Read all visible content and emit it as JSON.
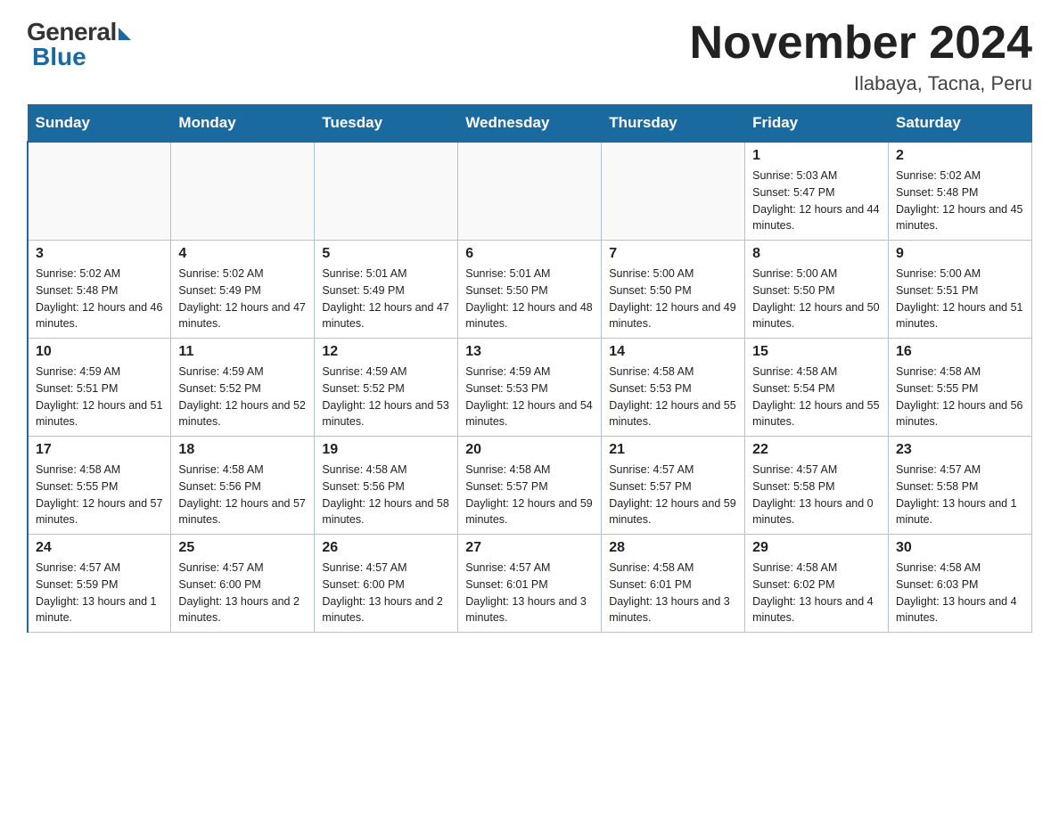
{
  "header": {
    "logo_general": "General",
    "logo_blue": "Blue",
    "title": "November 2024",
    "subtitle": "Ilabaya, Tacna, Peru"
  },
  "days_of_week": [
    "Sunday",
    "Monday",
    "Tuesday",
    "Wednesday",
    "Thursday",
    "Friday",
    "Saturday"
  ],
  "weeks": [
    [
      {
        "day": "",
        "info": ""
      },
      {
        "day": "",
        "info": ""
      },
      {
        "day": "",
        "info": ""
      },
      {
        "day": "",
        "info": ""
      },
      {
        "day": "",
        "info": ""
      },
      {
        "day": "1",
        "info": "Sunrise: 5:03 AM\nSunset: 5:47 PM\nDaylight: 12 hours and 44 minutes."
      },
      {
        "day": "2",
        "info": "Sunrise: 5:02 AM\nSunset: 5:48 PM\nDaylight: 12 hours and 45 minutes."
      }
    ],
    [
      {
        "day": "3",
        "info": "Sunrise: 5:02 AM\nSunset: 5:48 PM\nDaylight: 12 hours and 46 minutes."
      },
      {
        "day": "4",
        "info": "Sunrise: 5:02 AM\nSunset: 5:49 PM\nDaylight: 12 hours and 47 minutes."
      },
      {
        "day": "5",
        "info": "Sunrise: 5:01 AM\nSunset: 5:49 PM\nDaylight: 12 hours and 47 minutes."
      },
      {
        "day": "6",
        "info": "Sunrise: 5:01 AM\nSunset: 5:50 PM\nDaylight: 12 hours and 48 minutes."
      },
      {
        "day": "7",
        "info": "Sunrise: 5:00 AM\nSunset: 5:50 PM\nDaylight: 12 hours and 49 minutes."
      },
      {
        "day": "8",
        "info": "Sunrise: 5:00 AM\nSunset: 5:50 PM\nDaylight: 12 hours and 50 minutes."
      },
      {
        "day": "9",
        "info": "Sunrise: 5:00 AM\nSunset: 5:51 PM\nDaylight: 12 hours and 51 minutes."
      }
    ],
    [
      {
        "day": "10",
        "info": "Sunrise: 4:59 AM\nSunset: 5:51 PM\nDaylight: 12 hours and 51 minutes."
      },
      {
        "day": "11",
        "info": "Sunrise: 4:59 AM\nSunset: 5:52 PM\nDaylight: 12 hours and 52 minutes."
      },
      {
        "day": "12",
        "info": "Sunrise: 4:59 AM\nSunset: 5:52 PM\nDaylight: 12 hours and 53 minutes."
      },
      {
        "day": "13",
        "info": "Sunrise: 4:59 AM\nSunset: 5:53 PM\nDaylight: 12 hours and 54 minutes."
      },
      {
        "day": "14",
        "info": "Sunrise: 4:58 AM\nSunset: 5:53 PM\nDaylight: 12 hours and 55 minutes."
      },
      {
        "day": "15",
        "info": "Sunrise: 4:58 AM\nSunset: 5:54 PM\nDaylight: 12 hours and 55 minutes."
      },
      {
        "day": "16",
        "info": "Sunrise: 4:58 AM\nSunset: 5:55 PM\nDaylight: 12 hours and 56 minutes."
      }
    ],
    [
      {
        "day": "17",
        "info": "Sunrise: 4:58 AM\nSunset: 5:55 PM\nDaylight: 12 hours and 57 minutes."
      },
      {
        "day": "18",
        "info": "Sunrise: 4:58 AM\nSunset: 5:56 PM\nDaylight: 12 hours and 57 minutes."
      },
      {
        "day": "19",
        "info": "Sunrise: 4:58 AM\nSunset: 5:56 PM\nDaylight: 12 hours and 58 minutes."
      },
      {
        "day": "20",
        "info": "Sunrise: 4:58 AM\nSunset: 5:57 PM\nDaylight: 12 hours and 59 minutes."
      },
      {
        "day": "21",
        "info": "Sunrise: 4:57 AM\nSunset: 5:57 PM\nDaylight: 12 hours and 59 minutes."
      },
      {
        "day": "22",
        "info": "Sunrise: 4:57 AM\nSunset: 5:58 PM\nDaylight: 13 hours and 0 minutes."
      },
      {
        "day": "23",
        "info": "Sunrise: 4:57 AM\nSunset: 5:58 PM\nDaylight: 13 hours and 1 minute."
      }
    ],
    [
      {
        "day": "24",
        "info": "Sunrise: 4:57 AM\nSunset: 5:59 PM\nDaylight: 13 hours and 1 minute."
      },
      {
        "day": "25",
        "info": "Sunrise: 4:57 AM\nSunset: 6:00 PM\nDaylight: 13 hours and 2 minutes."
      },
      {
        "day": "26",
        "info": "Sunrise: 4:57 AM\nSunset: 6:00 PM\nDaylight: 13 hours and 2 minutes."
      },
      {
        "day": "27",
        "info": "Sunrise: 4:57 AM\nSunset: 6:01 PM\nDaylight: 13 hours and 3 minutes."
      },
      {
        "day": "28",
        "info": "Sunrise: 4:58 AM\nSunset: 6:01 PM\nDaylight: 13 hours and 3 minutes."
      },
      {
        "day": "29",
        "info": "Sunrise: 4:58 AM\nSunset: 6:02 PM\nDaylight: 13 hours and 4 minutes."
      },
      {
        "day": "30",
        "info": "Sunrise: 4:58 AM\nSunset: 6:03 PM\nDaylight: 13 hours and 4 minutes."
      }
    ]
  ]
}
